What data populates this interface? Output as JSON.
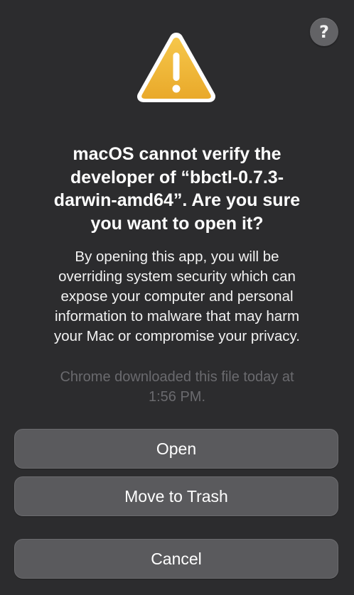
{
  "help_button": {
    "glyph": "?",
    "icon": "question-mark-icon"
  },
  "alert_icon": {
    "name": "warning-triangle-icon",
    "glyph": "!",
    "fill_color": "#f2b53b",
    "border_color": "#ffffff"
  },
  "title": "macOS cannot verify the\ndeveloper of “bbctl-0.7.3-\ndarwin-amd64”. Are you sure\nyou want to open it?",
  "message": "By opening this app, you will be\noverriding system security which can\nexpose your computer and personal\ninformation to malware that may harm\nyour Mac or compromise your privacy.",
  "download_note": "Chrome downloaded this file today at\n1:56 PM.",
  "buttons": {
    "open": "Open",
    "move_to_trash": "Move to Trash",
    "cancel": "Cancel"
  },
  "colors": {
    "dialog_background": "#2c2c2e",
    "button_background": "#5a5a5d",
    "secondary_text": "#6a6a6e"
  }
}
